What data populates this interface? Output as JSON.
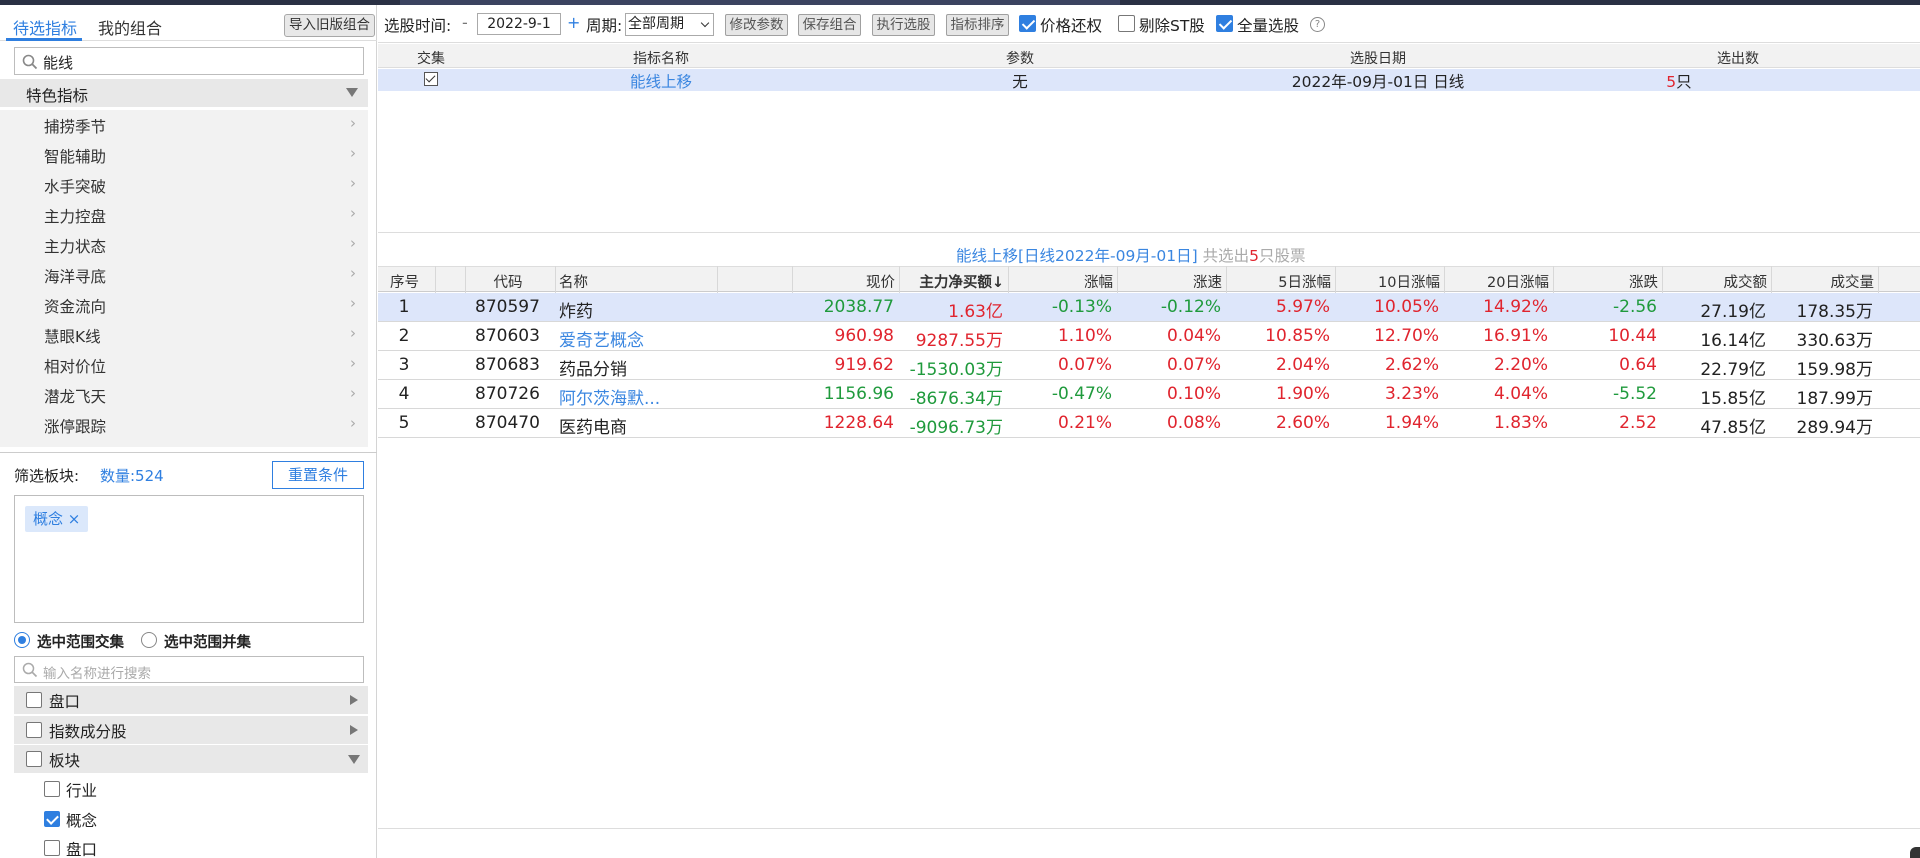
{
  "left": {
    "tabs": [
      "待选指标",
      "我的组合"
    ],
    "import_button": "导入旧版组合",
    "search_value": "能线",
    "category": "特色指标",
    "items": [
      "捕捞季节",
      "智能辅助",
      "水手突破",
      "主力控盘",
      "主力状态",
      "海洋寻底",
      "资金流向",
      "慧眼K线",
      "相对价位",
      "潜龙飞天",
      "涨停跟踪"
    ],
    "filter_label": "筛选板块:",
    "count_label": "数量:524",
    "reset_button": "重置条件",
    "tag": "概念 ×",
    "radio_intersection": "选中范围交集",
    "radio_union": "选中范围并集",
    "search2_placeholder": "输入名称进行搜索",
    "tree": {
      "pankou": "盘口",
      "index_components": "指数成分股",
      "sector": "板块",
      "industry": "行业",
      "concept": "概念",
      "pankou2": "盘口"
    }
  },
  "toolbar": {
    "time_label": "选股时间:",
    "minus": "-",
    "date": "2022-9-1",
    "plus": "+",
    "period_label": "周期:",
    "period_value": "全部周期",
    "modify_params": "修改参数",
    "save_combo": "保存组合",
    "run_select": "执行选股",
    "sort_indicators": "指标排序",
    "price_restore": "价格还权",
    "exclude_st": "剔除ST股",
    "full_select": "全量选股",
    "help": "?"
  },
  "indicator_table": {
    "headers": [
      "交集",
      "指标名称",
      "参数",
      "选股日期",
      "选出数"
    ],
    "row": {
      "name": "能线上移",
      "param": "无",
      "date": "2022年-09月-01日 日线",
      "count_num": "5",
      "count_unit": "只"
    }
  },
  "summary": {
    "part1": "能线上移[日线2022年-09月-01日]",
    "part2": " 共选出",
    "num": "5",
    "part3": "只股票"
  },
  "results": {
    "headers": [
      "序号",
      "代码",
      "名称",
      "现价",
      "主力净买额↓",
      "涨幅",
      "涨速",
      "5日涨幅",
      "10日涨幅",
      "20日涨幅",
      "涨跌",
      "成交额",
      "成交量"
    ],
    "rows": [
      {
        "no": "1",
        "code": "870597",
        "name": "炸药",
        "price": "2038.77",
        "net": "1.63亿",
        "chg": "-0.13%",
        "speed": "-0.12%",
        "d5": "5.97%",
        "d10": "10.05%",
        "d20": "14.92%",
        "diff": "-2.56",
        "amount": "27.19亿",
        "volume": "178.35万"
      },
      {
        "no": "2",
        "code": "870603",
        "name": "爱奇艺概念",
        "price": "960.98",
        "net": "9287.55万",
        "chg": "1.10%",
        "speed": "0.04%",
        "d5": "10.85%",
        "d10": "12.70%",
        "d20": "16.91%",
        "diff": "10.44",
        "amount": "16.14亿",
        "volume": "330.63万"
      },
      {
        "no": "3",
        "code": "870683",
        "name": "药品分销",
        "price": "919.62",
        "net": "-1530.03万",
        "chg": "0.07%",
        "speed": "0.07%",
        "d5": "2.04%",
        "d10": "2.62%",
        "d20": "2.20%",
        "diff": "0.64",
        "amount": "22.79亿",
        "volume": "159.98万"
      },
      {
        "no": "4",
        "code": "870726",
        "name": "阿尔茨海默...",
        "price": "1156.96",
        "net": "-8676.34万",
        "chg": "-0.47%",
        "speed": "0.10%",
        "d5": "1.90%",
        "d10": "3.23%",
        "d20": "4.04%",
        "diff": "-5.52",
        "amount": "15.85亿",
        "volume": "187.99万"
      },
      {
        "no": "5",
        "code": "870470",
        "name": "医药电商",
        "price": "1228.64",
        "net": "-9096.73万",
        "chg": "0.21%",
        "speed": "0.08%",
        "d5": "2.60%",
        "d10": "1.94%",
        "d20": "1.83%",
        "diff": "2.52",
        "amount": "47.85亿",
        "volume": "289.94万"
      }
    ]
  },
  "colors": {
    "accent": "#2f7fe0",
    "up": "#e0242e",
    "down": "#1f9a3c",
    "link": "#3a86e0",
    "selected_row": "#dde6fa"
  }
}
